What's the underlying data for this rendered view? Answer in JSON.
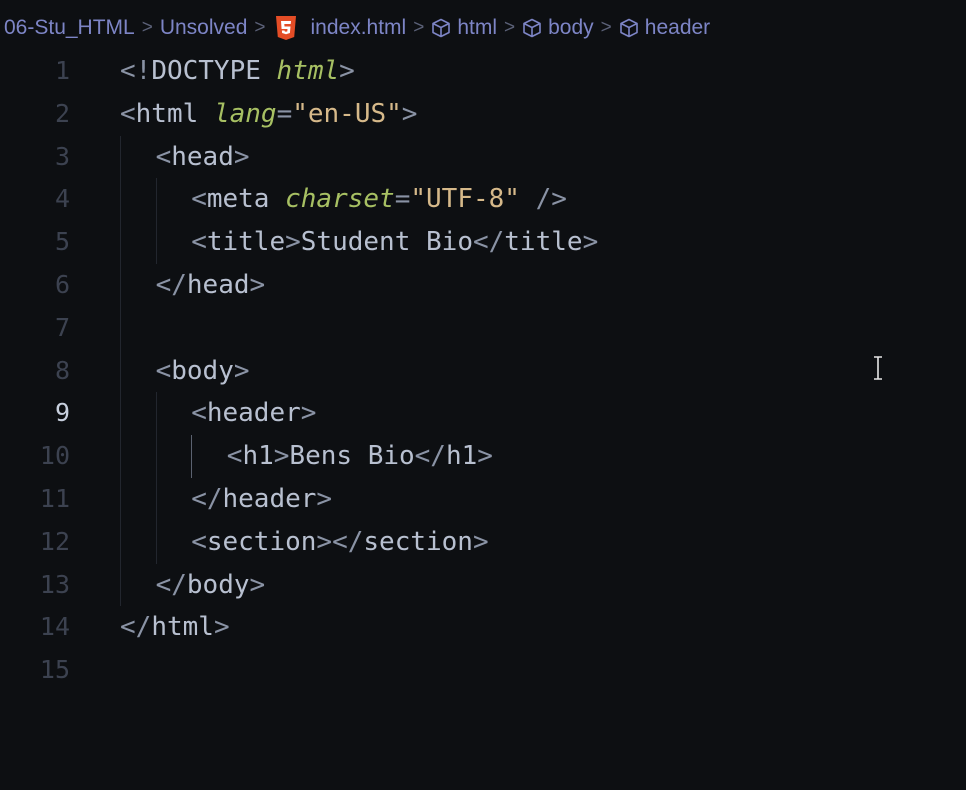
{
  "breadcrumb": {
    "items": [
      {
        "label": "06-Stu_HTML",
        "icon": ""
      },
      {
        "label": "Unsolved",
        "icon": ""
      },
      {
        "label": "index.html",
        "icon": "html5-icon"
      },
      {
        "label": "html",
        "icon": "cube-icon"
      },
      {
        "label": "body",
        "icon": "cube-icon"
      },
      {
        "label": "header",
        "icon": "cube-icon"
      }
    ],
    "separator": ">"
  },
  "editor": {
    "active_line": 9,
    "lines": [
      {
        "n": "1",
        "indent": 0,
        "tokens": [
          [
            "punc",
            "<!"
          ],
          [
            "doctype",
            "DOCTYPE "
          ],
          [
            "attr",
            "html"
          ],
          [
            "punc",
            ">"
          ]
        ]
      },
      {
        "n": "2",
        "indent": 0,
        "tokens": [
          [
            "punc",
            "<"
          ],
          [
            "tag",
            "html "
          ],
          [
            "attr",
            "lang"
          ],
          [
            "punc",
            "="
          ],
          [
            "str",
            "\"en-US\""
          ],
          [
            "punc",
            ">"
          ]
        ]
      },
      {
        "n": "3",
        "indent": 1,
        "tokens": [
          [
            "punc",
            "<"
          ],
          [
            "tag",
            "head"
          ],
          [
            "punc",
            ">"
          ]
        ]
      },
      {
        "n": "4",
        "indent": 2,
        "tokens": [
          [
            "punc",
            "<"
          ],
          [
            "tag",
            "meta "
          ],
          [
            "attr",
            "charset"
          ],
          [
            "punc",
            "="
          ],
          [
            "str",
            "\"UTF-8\""
          ],
          [
            "punc",
            " />"
          ]
        ]
      },
      {
        "n": "5",
        "indent": 2,
        "tokens": [
          [
            "punc",
            "<"
          ],
          [
            "tag",
            "title"
          ],
          [
            "punc",
            ">"
          ],
          [
            "text",
            "Student Bio"
          ],
          [
            "punc",
            "</"
          ],
          [
            "tag",
            "title"
          ],
          [
            "punc",
            ">"
          ]
        ]
      },
      {
        "n": "6",
        "indent": 1,
        "tokens": [
          [
            "punc",
            "</"
          ],
          [
            "tag",
            "head"
          ],
          [
            "punc",
            ">"
          ]
        ]
      },
      {
        "n": "7",
        "indent": 1,
        "tokens": []
      },
      {
        "n": "8",
        "indent": 1,
        "tokens": [
          [
            "punc",
            "<"
          ],
          [
            "tag",
            "body"
          ],
          [
            "punc",
            ">"
          ]
        ]
      },
      {
        "n": "9",
        "indent": 2,
        "tokens": [
          [
            "punc",
            "<"
          ],
          [
            "tag",
            "header"
          ],
          [
            "punc",
            ">"
          ]
        ]
      },
      {
        "n": "10",
        "indent": 3,
        "tokens": [
          [
            "punc",
            "<"
          ],
          [
            "tag",
            "h1"
          ],
          [
            "punc",
            ">"
          ],
          [
            "text",
            "Bens Bio"
          ],
          [
            "punc",
            "</"
          ],
          [
            "tag",
            "h1"
          ],
          [
            "punc",
            ">"
          ]
        ]
      },
      {
        "n": "11",
        "indent": 2,
        "tokens": [
          [
            "punc",
            "</"
          ],
          [
            "tag",
            "header"
          ],
          [
            "punc",
            ">"
          ]
        ]
      },
      {
        "n": "12",
        "indent": 2,
        "tokens": [
          [
            "punc",
            "<"
          ],
          [
            "tag",
            "section"
          ],
          [
            "punc",
            "></"
          ],
          [
            "tag",
            "section"
          ],
          [
            "punc",
            ">"
          ]
        ]
      },
      {
        "n": "13",
        "indent": 1,
        "tokens": [
          [
            "punc",
            "</"
          ],
          [
            "tag",
            "body"
          ],
          [
            "punc",
            ">"
          ]
        ]
      },
      {
        "n": "14",
        "indent": 0,
        "tokens": [
          [
            "punc",
            "</"
          ],
          [
            "tag",
            "html"
          ],
          [
            "punc",
            ">"
          ]
        ]
      },
      {
        "n": "15",
        "indent": 0,
        "tokens": []
      }
    ]
  },
  "colors": {
    "background": "#0d0f12",
    "breadcrumb": "#7d85c6",
    "attribute": "#a7c063",
    "string": "#d6b98a",
    "tag": "#b8c0d0",
    "line_number": "#3c4250",
    "html5_orange": "#e44d26"
  }
}
